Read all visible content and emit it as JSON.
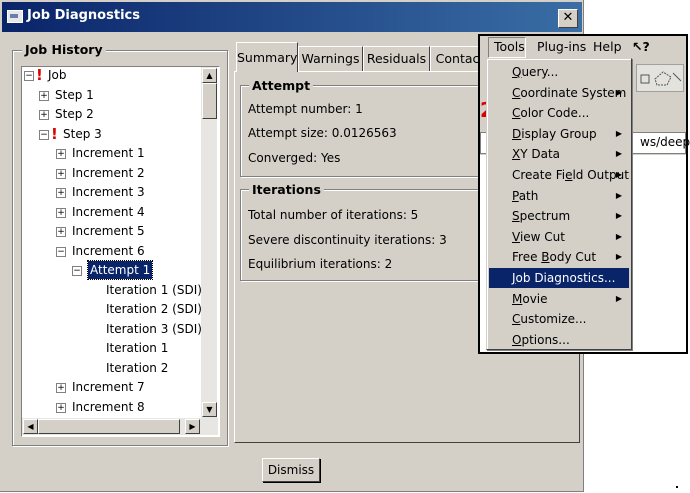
{
  "dialog": {
    "title": "Job Diagnostics",
    "close_glyph": "✕",
    "dismiss_label": "Dismiss"
  },
  "job_history": {
    "title": "Job History",
    "nodes": [
      {
        "label": "Job",
        "exp": "⊟",
        "bang": "!"
      },
      {
        "label": "Step 1",
        "exp": "+"
      },
      {
        "label": "Step 2",
        "exp": "+"
      },
      {
        "label": "Step 3",
        "exp": "−",
        "bang": "!"
      },
      {
        "label": "Increment 1",
        "exp": "+"
      },
      {
        "label": "Increment 2",
        "exp": "+"
      },
      {
        "label": "Increment 3",
        "exp": "+"
      },
      {
        "label": "Increment 4",
        "exp": "+"
      },
      {
        "label": "Increment 5",
        "exp": "+"
      },
      {
        "label": "Increment 6",
        "exp": "−"
      },
      {
        "label": "Attempt 1",
        "exp": "−"
      },
      {
        "label": "Iteration 1 (SDI)"
      },
      {
        "label": "Iteration 2 (SDI)"
      },
      {
        "label": "Iteration 3 (SDI)"
      },
      {
        "label": "Iteration 1"
      },
      {
        "label": "Iteration 2"
      },
      {
        "label": "Increment 7",
        "exp": "+"
      },
      {
        "label": "Increment 8",
        "exp": "+"
      }
    ]
  },
  "tabs": [
    {
      "label": "Summary"
    },
    {
      "label": "Warnings"
    },
    {
      "label": "Residuals"
    },
    {
      "label": "Contact"
    }
  ],
  "summary": {
    "attempt_title": "Attempt",
    "attempt_number": "Attempt number: 1",
    "attempt_size": "Attempt size: 0.0126563",
    "converged": "Converged: Yes",
    "iterations_title": "Iterations",
    "total_iterations": "Total number of iterations: 5",
    "severe_discontinuity": "Severe discontinuity iterations: 3",
    "equilibrium": "Equilibrium iterations: 2"
  },
  "background": {
    "red_digit": "2",
    "path_fragment": "ws/deepc"
  },
  "menubar": {
    "tools": "Tools",
    "plugins": "Plug-ins",
    "help": "Help",
    "whats_this": "↖?"
  },
  "tools_menu": [
    {
      "label": "Query...",
      "submenu": false
    },
    {
      "label": "Coordinate System",
      "submenu": true
    },
    {
      "label": "Color Code...",
      "submenu": false
    },
    {
      "label": "Display Group",
      "submenu": true
    },
    {
      "label": "XY Data",
      "submenu": true
    },
    {
      "label": "Create Field Output",
      "submenu": true
    },
    {
      "label": "Path",
      "submenu": true
    },
    {
      "label": "Spectrum",
      "submenu": true
    },
    {
      "label": "View Cut",
      "submenu": true
    },
    {
      "label": "Free Body Cut",
      "submenu": true
    },
    {
      "label": "Job Diagnostics...",
      "submenu": false,
      "highlighted": true
    },
    {
      "label": "Movie",
      "submenu": true
    },
    {
      "label": "Customize...",
      "submenu": false
    },
    {
      "label": "Options...",
      "submenu": false
    }
  ],
  "colors": {
    "title_blue": "#0a246a",
    "face": "#d4d0c8",
    "error_red": "#d80000"
  }
}
